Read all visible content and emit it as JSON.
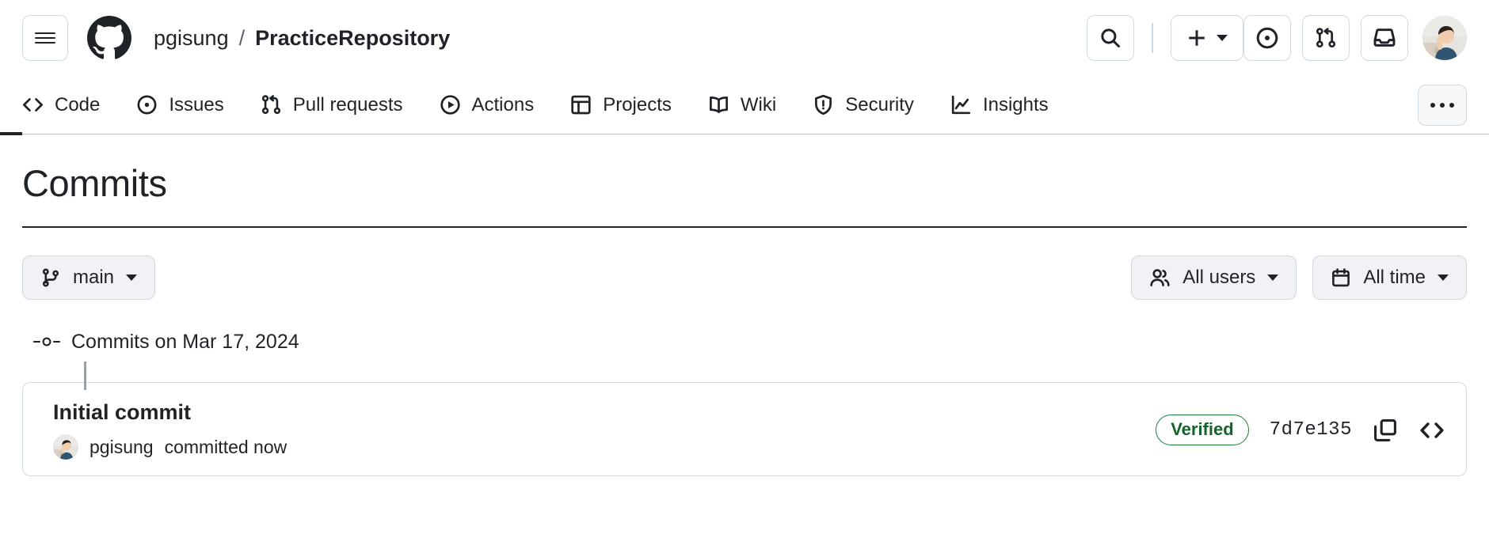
{
  "header": {
    "menu_button": "menu-icon",
    "logo": "github-logo",
    "breadcrumb": {
      "owner": "pgisung",
      "separator": "/",
      "repo": "PracticeRepository"
    },
    "actions": {
      "search": "search-icon",
      "create_new": "plus-icon",
      "issues": "issue-opened-icon",
      "pull_requests": "pull-request-icon",
      "inbox": "inbox-icon",
      "avatar": "user-avatar"
    }
  },
  "repo_nav": {
    "items": [
      {
        "label": "Code",
        "icon": "code-icon",
        "active": true
      },
      {
        "label": "Issues",
        "icon": "issue-opened-icon",
        "active": false
      },
      {
        "label": "Pull requests",
        "icon": "pull-request-icon",
        "active": false
      },
      {
        "label": "Actions",
        "icon": "play-icon",
        "active": false
      },
      {
        "label": "Projects",
        "icon": "table-icon",
        "active": false
      },
      {
        "label": "Wiki",
        "icon": "book-icon",
        "active": false
      },
      {
        "label": "Security",
        "icon": "shield-icon",
        "active": false
      },
      {
        "label": "Insights",
        "icon": "graph-icon",
        "active": false
      }
    ],
    "overflow": "kebab-horizontal-icon"
  },
  "main": {
    "page_title": "Commits",
    "branch_selector": {
      "label": "main",
      "icon": "git-branch-icon"
    },
    "filters": [
      {
        "label": "All users",
        "icon": "people-icon"
      },
      {
        "label": "All time",
        "icon": "calendar-icon"
      }
    ],
    "commit_groups": [
      {
        "heading": "Commits on Mar 17, 2024",
        "commits": [
          {
            "title": "Initial commit",
            "author": "pgisung",
            "action_text": "committed now",
            "verified_label": "Verified",
            "sha": "7d7e135",
            "copy_icon": "copy-icon",
            "browse_icon": "code-icon"
          }
        ]
      }
    ]
  },
  "colors": {
    "accent_green": "#1a7f37",
    "verified_text": "#116329",
    "border": "#d1d9e0",
    "text": "#1f2328",
    "muted": "#59636e",
    "button_bg": "#f0f2f5"
  }
}
